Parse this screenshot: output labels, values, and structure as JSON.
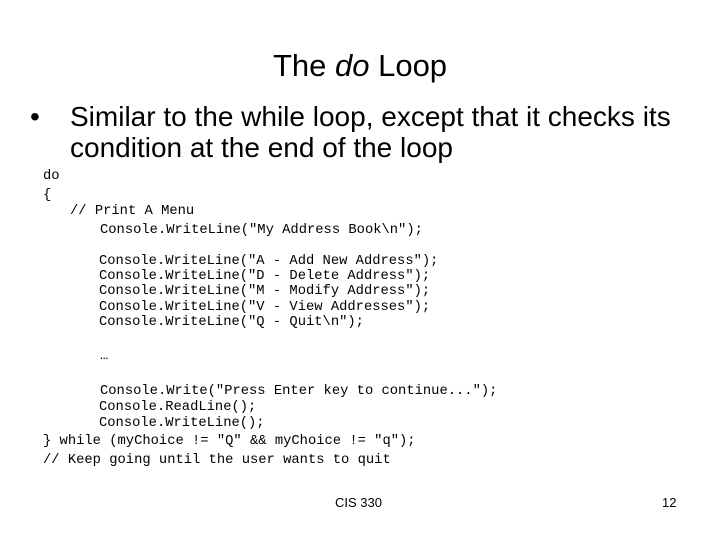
{
  "slide": {
    "title_prefix": "The ",
    "title_emph": "do",
    "title_suffix": " Loop",
    "bullet_glyph": "•",
    "bullet_text": "Similar to the while loop, except that it checks its condition at the end of the loop",
    "code_lines": [
      "do",
      "{",
      "// Print A Menu",
      "Console.WriteLine(\"My Address Book\\n\");",
      "Console.WriteLine(\"A - Add New Address\");",
      "Console.WriteLine(\"D - Delete Address\");",
      "Console.WriteLine(\"M - Modify Address\");",
      "Console.WriteLine(\"V - View Addresses\");",
      "Console.WriteLine(\"Q - Quit\\n\");",
      "…",
      "Console.Write(\"Press Enter key to continue...\");",
      "Console.ReadLine();",
      "Console.WriteLine();",
      "} while (myChoice != \"Q\" && myChoice != \"q\");",
      "// Keep going until the user wants to quit"
    ],
    "footer_course": "CIS 330",
    "page_number": "12"
  }
}
